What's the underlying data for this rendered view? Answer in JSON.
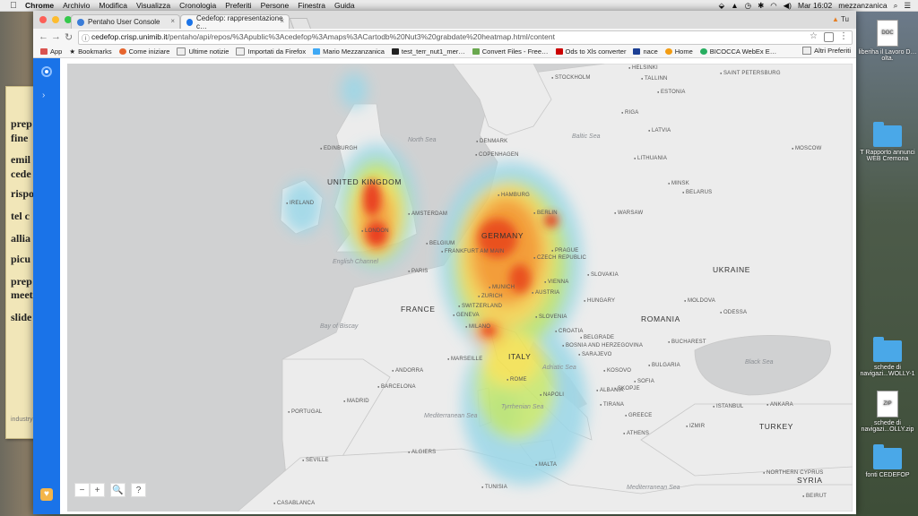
{
  "menubar": {
    "app": "Chrome",
    "items": [
      "Archivio",
      "Modifica",
      "Visualizza",
      "Cronologia",
      "Preferiti",
      "Persone",
      "Finestra",
      "Guida"
    ],
    "clock": "Mar 16:02",
    "user": "mezzanzanica"
  },
  "browser": {
    "tabs": [
      {
        "title": "Pentaho User Console",
        "close": "×"
      },
      {
        "title": "Cedefop: rappresentazione c…",
        "close": "×"
      }
    ],
    "profile": "Tu",
    "url_host": "cedefop.crisp.unimib.it",
    "url_path": "/pentaho/api/repos/%3Apublic%3Acedefop%3Amaps%3ACartodb%20Nut3%20grabdate%20heatmap.html/content",
    "bookmarks": [
      {
        "label": "App",
        "color": "#d9534f"
      },
      {
        "label": "Bookmarks",
        "color": "#555555"
      },
      {
        "label": "Come iniziare",
        "color": "#e6642d"
      },
      {
        "label": "Ultime notizie",
        "color": "#888888"
      },
      {
        "label": "Importati da Firefox",
        "color": "#888888"
      },
      {
        "label": "Mario Mezzanzanica",
        "color": "#3fa9f5"
      },
      {
        "label": "test_terr_nut1_mer…",
        "color": "#222222"
      },
      {
        "label": "Convert Files - Free…",
        "color": "#6aa84f"
      },
      {
        "label": "Ods to Xls converter",
        "color": "#cc0000"
      },
      {
        "label": "nace",
        "color": "#1c3f94"
      },
      {
        "label": "Home",
        "color": "#f39c12"
      },
      {
        "label": "BICOCCA WebEx E…",
        "color": "#27ae60"
      }
    ],
    "bookmarks_other": "Altri Preferiti"
  },
  "map": {
    "countries": [
      {
        "name": "UNITED KINGDOM",
        "kind": "big"
      },
      {
        "name": "IRELAND",
        "kind": "big"
      },
      {
        "name": "GERMANY",
        "kind": "big"
      },
      {
        "name": "FRANCE",
        "kind": "big"
      },
      {
        "name": "ITALY",
        "kind": "big"
      },
      {
        "name": "ROMANIA",
        "kind": "big"
      },
      {
        "name": "UKRAINE",
        "kind": "big"
      },
      {
        "name": "TURKEY",
        "kind": "big"
      },
      {
        "name": "SYRIA",
        "kind": "big"
      },
      {
        "name": "BELGIUM",
        "kind": "country"
      },
      {
        "name": "CZECH REPUBLIC",
        "kind": "country"
      },
      {
        "name": "AUSTRIA",
        "kind": "country"
      },
      {
        "name": "SWITZERLAND",
        "kind": "country"
      },
      {
        "name": "SLOVAKIA",
        "kind": "country"
      },
      {
        "name": "HUNGARY",
        "kind": "country"
      },
      {
        "name": "SLOVENIA",
        "kind": "country"
      },
      {
        "name": "CROATIA",
        "kind": "country"
      },
      {
        "name": "BOSNIA AND HERZEGOVINA",
        "kind": "country"
      },
      {
        "name": "MOLDOVA",
        "kind": "country"
      },
      {
        "name": "BULGARIA",
        "kind": "country"
      },
      {
        "name": "KOSOVO",
        "kind": "country"
      },
      {
        "name": "ALBANIA",
        "kind": "country"
      },
      {
        "name": "GREECE",
        "kind": "country"
      },
      {
        "name": "PORTUGAL",
        "kind": "country"
      },
      {
        "name": "ANDORRA",
        "kind": "country"
      },
      {
        "name": "MALTA",
        "kind": "country"
      },
      {
        "name": "TUNISIA",
        "kind": "country"
      },
      {
        "name": "LATVIA",
        "kind": "country"
      },
      {
        "name": "LITHUANIA",
        "kind": "country"
      },
      {
        "name": "ESTONIA",
        "kind": "country"
      },
      {
        "name": "BELARUS",
        "kind": "country"
      },
      {
        "name": "DENMARK",
        "kind": "country"
      },
      {
        "name": "NORTHERN CYPRUS",
        "kind": "country"
      }
    ],
    "cities": [
      "EDINBURGH",
      "LONDON",
      "AMSTERDAM",
      "HAMBURG",
      "BERLIN",
      "FRANKFURT AM MAIN",
      "PRAGUE",
      "MUNICH",
      "VIENNA",
      "ZURICH",
      "GENEVA",
      "MILANO",
      "MARSEILLE",
      "BARCELONA",
      "MADRID",
      "ROME",
      "NAPOLI",
      "PARIS",
      "WARSAW",
      "MINSK",
      "MOSCOW",
      "STOCKHOLM",
      "COPENHAGEN",
      "BELGRADE",
      "BUCHAREST",
      "SOFIA",
      "ISTANBUL",
      "ANKARA",
      "ATHENS",
      "ALGIERS",
      "IZMIR",
      "ODESSA",
      "BEIRUT",
      "RIGA",
      "SAINT PETERSBURG",
      "TALLINN",
      "HELSINKI",
      "CASABLANCA",
      "SEVILLE",
      "SARAJEVO",
      "TIRANA",
      "SKOPJE"
    ],
    "seas": [
      "North Sea",
      "Baltic Sea",
      "English Channel",
      "Bay of Biscay",
      "Adriatic Sea",
      "Tyrrhenian Sea",
      "Mediterranean Sea",
      "Black Sea",
      "Mediterranean Sea"
    ],
    "controls": {
      "zoom_out": "−",
      "zoom_in": "+",
      "search": "🔍",
      "help": "?"
    }
  },
  "desktop": {
    "note_lines": [
      "prep",
      "fine",
      "emil",
      "cede",
      "rispo",
      "tel c",
      "allia",
      "picu",
      "prep",
      "meet",
      "slide"
    ],
    "note_footer": "industry",
    "icons": [
      {
        "label": "liberiha il Lavoro D…olta.",
        "type": "doc"
      },
      {
        "label": "T Rapporto annunci WEB Cremona",
        "type": "folder"
      },
      {
        "label": "schede di navigazi...WOLLY-1",
        "type": "folder"
      },
      {
        "label": "schede di navigazi...OLLY.zip",
        "type": "zip"
      },
      {
        "label": "fonti CEDEFOP",
        "type": "folder"
      }
    ]
  }
}
